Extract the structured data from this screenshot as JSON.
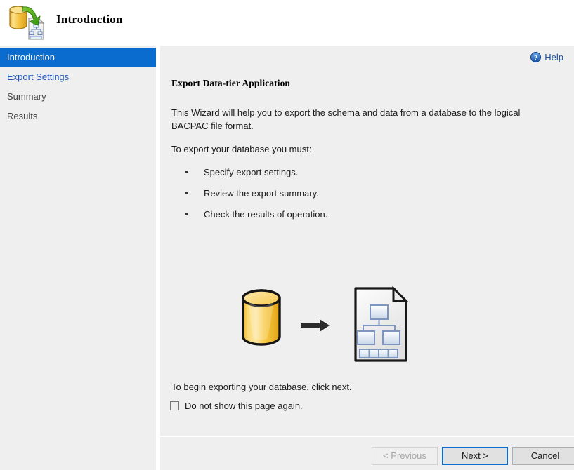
{
  "header": {
    "title": "Introduction",
    "icon": "database-export-icon"
  },
  "sidebar": {
    "items": [
      {
        "label": "Introduction",
        "state": "selected"
      },
      {
        "label": "Export Settings",
        "state": "link"
      },
      {
        "label": "Summary",
        "state": "normal"
      },
      {
        "label": "Results",
        "state": "normal"
      }
    ]
  },
  "content": {
    "help_label": "Help",
    "help_icon": "help-circle-icon",
    "heading": "Export Data-tier Application",
    "intro_paragraph": "This Wizard will help you to export the schema and data from a database to the logical BACPAC file format.",
    "must_line": "To export your database you must:",
    "steps": [
      "Specify export settings.",
      "Review the export summary.",
      "Check the results of operation."
    ],
    "illustration": {
      "source_icon": "database-cylinder-icon",
      "arrow_icon": "right-arrow-icon",
      "target_icon": "bacpac-document-icon"
    },
    "begin_line": "To begin exporting your database, click next.",
    "dont_show_label": "Do not show this page again.",
    "dont_show_checked": false
  },
  "footer": {
    "previous_label": "< Previous",
    "previous_disabled": true,
    "next_label": "Next >",
    "next_focused": true,
    "cancel_label": "Cancel"
  },
  "colors": {
    "accent_blue": "#0a6cce",
    "link_blue": "#1f57b5",
    "panel_gray": "#efefef",
    "button_gray": "#e1e1e1",
    "db_gold": "#f5c342"
  }
}
